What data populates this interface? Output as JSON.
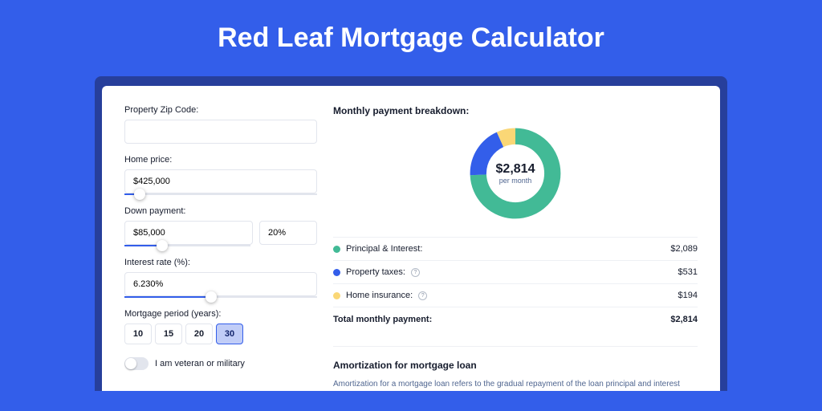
{
  "title": "Red Leaf Mortgage Calculator",
  "colors": {
    "pi": "#42ba96",
    "tax": "#335eea",
    "ins": "#fad776"
  },
  "form": {
    "zip_label": "Property Zip Code:",
    "zip_value": "",
    "price_label": "Home price:",
    "price_value": "$425,000",
    "price_slider_pct": 8,
    "down_label": "Down payment:",
    "down_value": "$85,000",
    "down_pct_value": "20%",
    "down_slider_pct": 30,
    "rate_label": "Interest rate (%):",
    "rate_value": "6.230%",
    "rate_slider_pct": 45,
    "period_label": "Mortgage period (years):",
    "periods": [
      "10",
      "15",
      "20",
      "30"
    ],
    "period_selected_index": 3,
    "veteran_label": "I am veteran or military",
    "veteran_on": false
  },
  "breakdown": {
    "title": "Monthly payment breakdown:",
    "center_amount": "$2,814",
    "center_sub": "per month",
    "items": [
      {
        "key": "pi",
        "label": "Principal & Interest:",
        "value": "$2,089",
        "info": false
      },
      {
        "key": "tax",
        "label": "Property taxes:",
        "value": "$531",
        "info": true
      },
      {
        "key": "ins",
        "label": "Home insurance:",
        "value": "$194",
        "info": true
      }
    ],
    "total_label": "Total monthly payment:",
    "total_value": "$2,814"
  },
  "amort": {
    "title": "Amortization for mortgage loan",
    "body": "Amortization for a mortgage loan refers to the gradual repayment of the loan principal and interest over a specified"
  },
  "chart_data": {
    "type": "pie",
    "title": "Monthly payment breakdown",
    "series": [
      {
        "name": "Principal & Interest",
        "value": 2089,
        "color": "#42ba96"
      },
      {
        "name": "Property taxes",
        "value": 531,
        "color": "#335eea"
      },
      {
        "name": "Home insurance",
        "value": 194,
        "color": "#fad776"
      }
    ],
    "total": 2814
  }
}
